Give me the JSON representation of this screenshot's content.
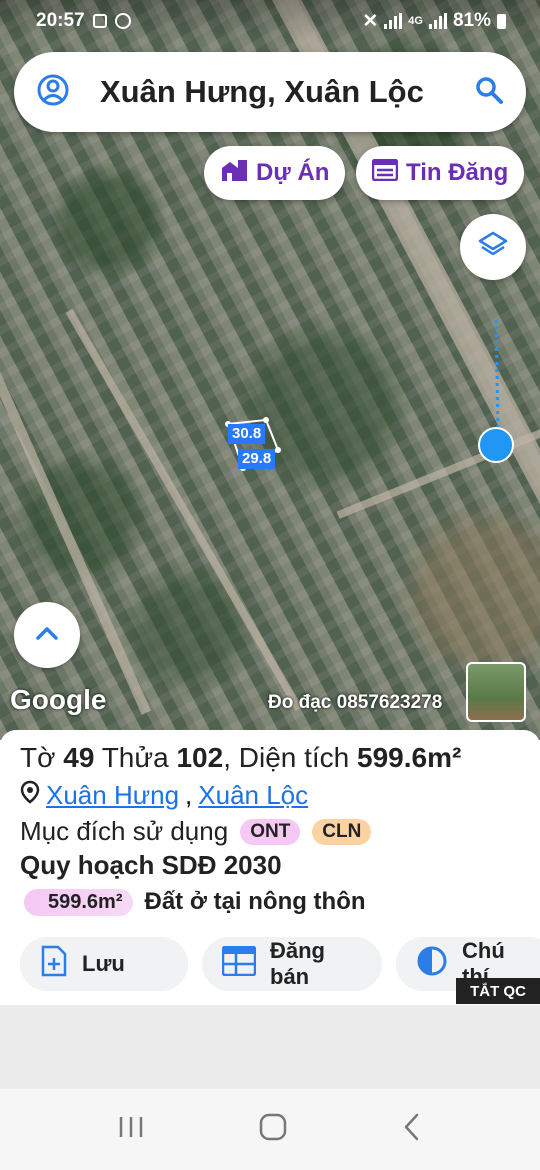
{
  "status_bar": {
    "time": "20:57",
    "battery": "81%",
    "network": "4G"
  },
  "search": {
    "text": "Xuân Hưng, Xuân Lộc"
  },
  "chips": {
    "projects": "Dự Án",
    "listings": "Tin Đăng"
  },
  "map": {
    "parcel_edge_a": "30.8",
    "parcel_edge_b": "29.8",
    "google_logo": "Google",
    "measure_text": "Đo đạc 0857623278"
  },
  "parcel": {
    "sheet_label": "Tờ",
    "sheet": "49",
    "plot_label": "Thửa",
    "plot": "102",
    "area_label": ", Diện tích",
    "area": "599.6m²",
    "commune": "Xuân Hưng",
    "district": "Xuân Lộc",
    "separator": ",",
    "use_label": "Mục đích sử dụng",
    "use_codes": [
      {
        "code": "ONT",
        "color": "#f6c8f4"
      },
      {
        "code": "CLN",
        "color": "#fbd3a2"
      }
    ],
    "plan_title": "Quy hoạch SDĐ 2030",
    "plan_area": "599.6m²",
    "plan_use": "Đất ở tại nông thôn"
  },
  "actions": {
    "save": "Lưu",
    "sell": "Đăng bán",
    "legend": "Chú thí"
  },
  "ad": {
    "hide": "TẮT QC"
  },
  "colors": {
    "accent_purple": "#6a2fb5",
    "link_blue": "#1a73e8",
    "parcel_blue": "#2979ff",
    "location_blue": "#2196f3"
  }
}
